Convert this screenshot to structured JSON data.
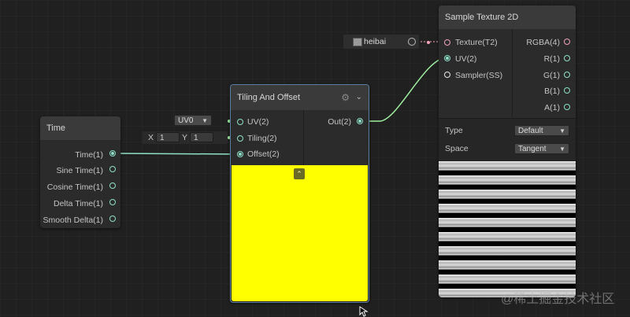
{
  "time_node": {
    "title": "Time",
    "outputs": [
      "Time(1)",
      "Sine Time(1)",
      "Cosine Time(1)",
      "Delta Time(1)",
      "Smooth Delta(1)"
    ]
  },
  "tiling_node": {
    "title": "Tiling And Offset",
    "inputs": [
      "UV(2)",
      "Tiling(2)",
      "Offset(2)"
    ],
    "output": "Out(2)",
    "uv_channel": "UV0",
    "tiling_x_label": "X",
    "tiling_x_value": "1",
    "tiling_y_label": "Y",
    "tiling_y_value": "1",
    "preview_color": "#ffff00"
  },
  "sample_node": {
    "title": "Sample Texture 2D",
    "inputs": [
      "Texture(T2)",
      "UV(2)",
      "Sampler(SS)"
    ],
    "outputs": [
      "RGBA(4)",
      "R(1)",
      "G(1)",
      "B(1)",
      "A(1)"
    ],
    "type_label": "Type",
    "type_value": "Default",
    "space_label": "Space",
    "space_value": "Tangent",
    "texture_name": "heibai"
  },
  "watermark": "@稀土掘金技术社区",
  "colors": {
    "accent_wire": "#8ee0c8",
    "wire_green": "#9ef0a0",
    "texture_port": "#f3a3b8"
  }
}
